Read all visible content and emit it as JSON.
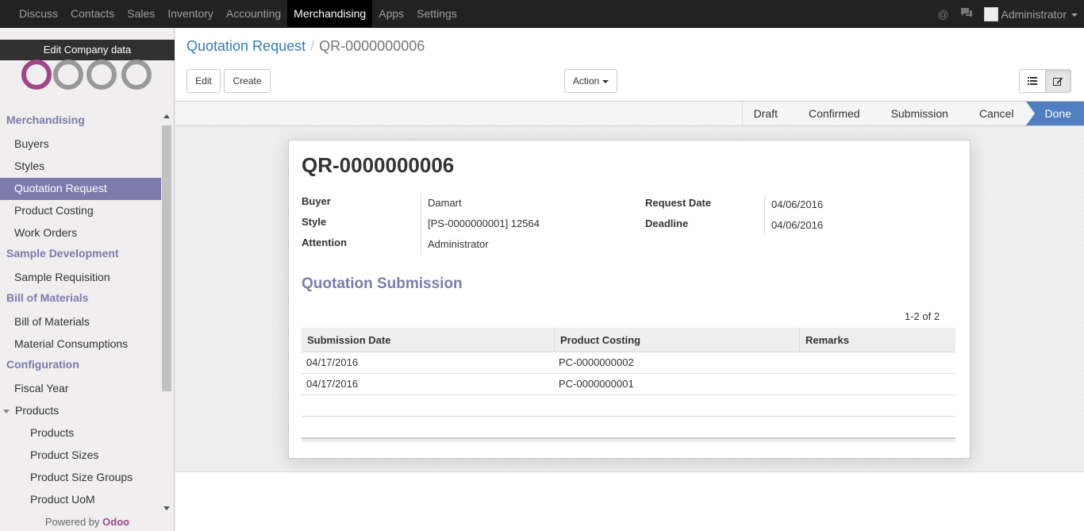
{
  "topbar": {
    "menu": [
      "Discuss",
      "Contacts",
      "Sales",
      "Inventory",
      "Accounting",
      "Merchandising",
      "Apps",
      "Settings"
    ],
    "active": "Merchandising",
    "user": "Administrator"
  },
  "sidebar": {
    "edit_company": "Edit Company data",
    "sections": [
      {
        "title": "Merchandising",
        "items": [
          "Buyers",
          "Styles",
          "Quotation Request",
          "Product Costing",
          "Work Orders"
        ]
      },
      {
        "title": "Sample Development",
        "items": [
          "Sample Requisition"
        ]
      },
      {
        "title": "Bill of Materials",
        "items": [
          "Bill of Materials",
          "Material Consumptions"
        ]
      },
      {
        "title": "Configuration",
        "items": [
          "Fiscal Year",
          "Products"
        ]
      }
    ],
    "products_sub": [
      "Products",
      "Product Sizes",
      "Product Size Groups",
      "Product UoM"
    ],
    "powered_by": "Powered by",
    "brand": "Odoo"
  },
  "breadcrumb": {
    "parent": "Quotation Request",
    "separator": "/",
    "current": "QR-0000000006"
  },
  "buttons": {
    "edit": "Edit",
    "create": "Create",
    "action": "Action"
  },
  "status": {
    "stages": [
      "Draft",
      "Confirmed",
      "Submission",
      "Cancel",
      "Done"
    ],
    "current": "Done"
  },
  "form": {
    "title": "QR-0000000006",
    "fields": {
      "buyer_label": "Buyer",
      "buyer": "Damart",
      "style_label": "Style",
      "style": "[PS-0000000001] 12564",
      "attention_label": "Attention",
      "attention": "Administrator",
      "request_date_label": "Request Date",
      "request_date": "04/06/2016",
      "deadline_label": "Deadline",
      "deadline": "04/06/2016"
    },
    "subtitle": "Quotation Submission",
    "pager": "1-2 of 2",
    "table": {
      "headers": [
        "Submission Date",
        "Product Costing",
        "Remarks"
      ],
      "rows": [
        [
          "04/17/2016",
          "PC-0000000002",
          ""
        ],
        [
          "04/17/2016",
          "PC-0000000001",
          ""
        ]
      ]
    }
  },
  "colors": {
    "brand": "#7c7bad",
    "status_done": "#4f7fc0",
    "logo": "#a24689"
  }
}
